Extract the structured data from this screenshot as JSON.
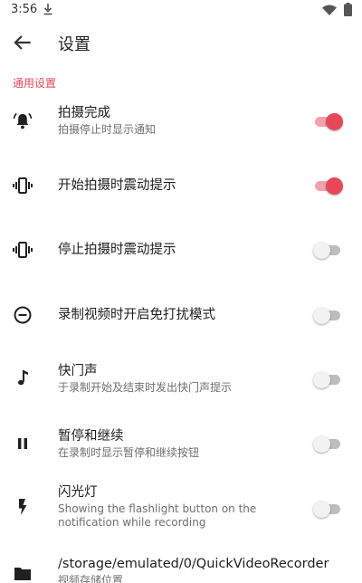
{
  "status_bar": {
    "time": "3:56"
  },
  "header": {
    "title": "设置"
  },
  "section": {
    "label": "通用设置"
  },
  "settings": [
    {
      "title": "拍摄完成",
      "subtitle": "拍摄停止时显示通知",
      "icon": "bell-ringing-icon",
      "switch_on": true
    },
    {
      "title": "开始拍摄时震动提示",
      "icon": "vibrate-icon",
      "switch_on": true
    },
    {
      "title": "停止拍摄时震动提示",
      "icon": "vibrate-icon",
      "switch_on": false
    },
    {
      "title": "录制视频时开启免打扰模式",
      "icon": "do-not-disturb-icon",
      "switch_on": false
    },
    {
      "title": "快门声",
      "subtitle": "于录制开始及结束时发出快门声提示",
      "icon": "music-note-icon",
      "switch_on": false
    },
    {
      "title": "暂停和继续",
      "subtitle": "在录制时显示暂停和继续按钮",
      "icon": "pause-icon",
      "switch_on": false
    },
    {
      "title": "闪光灯",
      "subtitle": "Showing the flashlight button on the notification while recording",
      "icon": "flash-icon",
      "switch_on": false
    },
    {
      "title": "/storage/emulated/0/QuickVideoRecorder",
      "subtitle": "视频存储位置",
      "icon": "folder-icon"
    }
  ],
  "colors": {
    "accent": "#e8475a",
    "switch_off_track": "#bdbdbd",
    "text_secondary": "#6f6f6f"
  }
}
